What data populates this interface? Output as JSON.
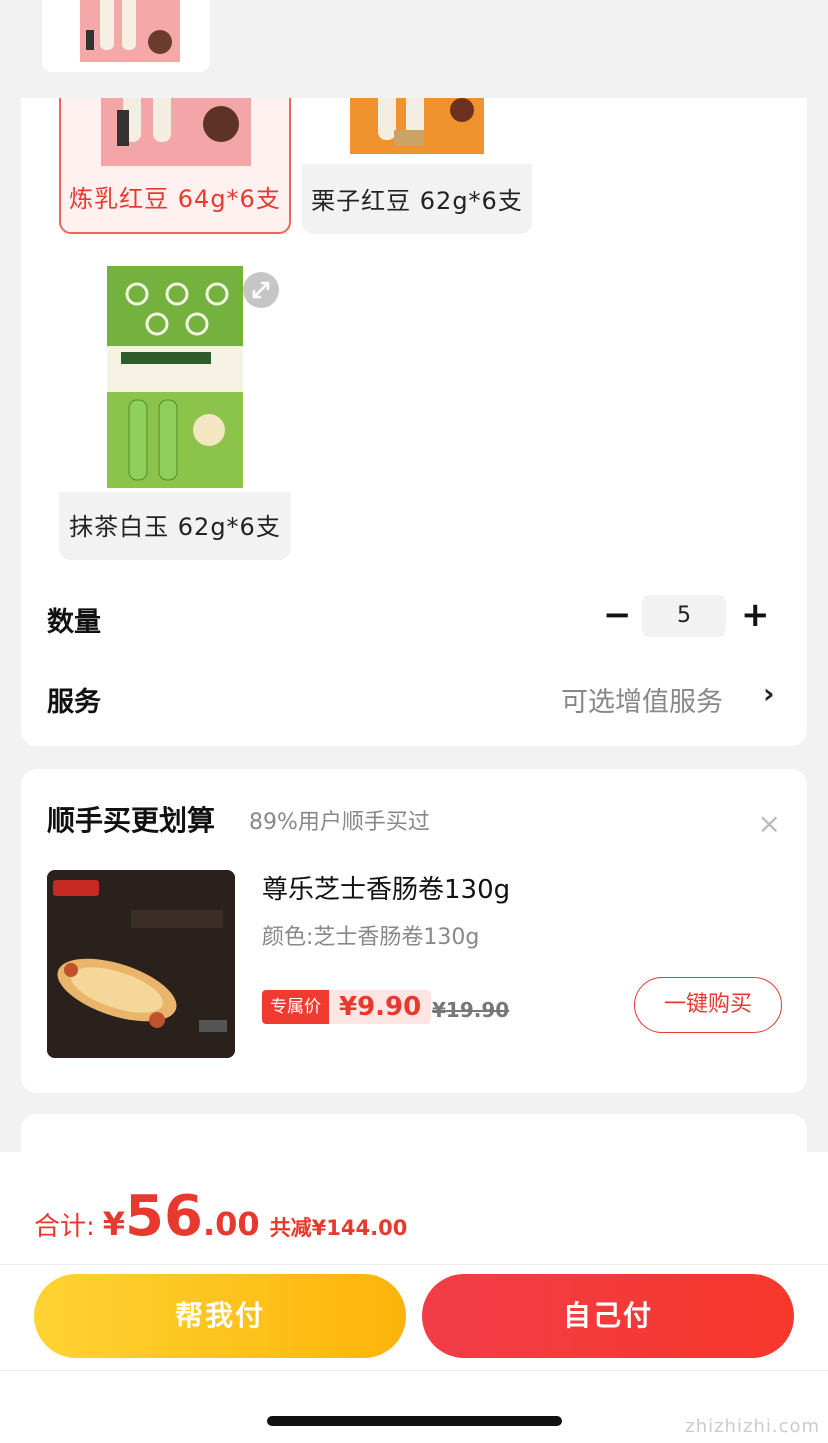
{
  "specs": [
    {
      "label": "炼乳红豆 64g*6支",
      "selected": true
    },
    {
      "label": "栗子红豆 62g*6支",
      "selected": false
    },
    {
      "label": "抹茶白玉 62g*6支",
      "selected": false
    }
  ],
  "quantity": {
    "label": "数量",
    "value": "5",
    "minus": "−",
    "plus": "+"
  },
  "service": {
    "label": "服务",
    "value": "可选增值服务",
    "chevron": "›"
  },
  "addon": {
    "title": "顺手买更划算",
    "subtitle": "89%用户顺手买过",
    "close": "×",
    "product": {
      "name": "尊乐芝士香肠卷130g",
      "color": "颜色:芝士香肠卷130g",
      "tag": "专属价",
      "price": "¥9.90",
      "old_price": "¥19.90",
      "buy_label": "一键购买"
    }
  },
  "footer": {
    "total_label": "合计:",
    "currency": "¥",
    "total_int": "56",
    "total_dec": ".00",
    "saving": "共减¥144.00",
    "help_pay": "帮我付",
    "self_pay": "自己付"
  },
  "watermark": "zhizhizhi.com",
  "colors": {
    "accent": "#e8392f",
    "help_btn": "#fdc21e",
    "self_btn": "#f23d3a"
  }
}
